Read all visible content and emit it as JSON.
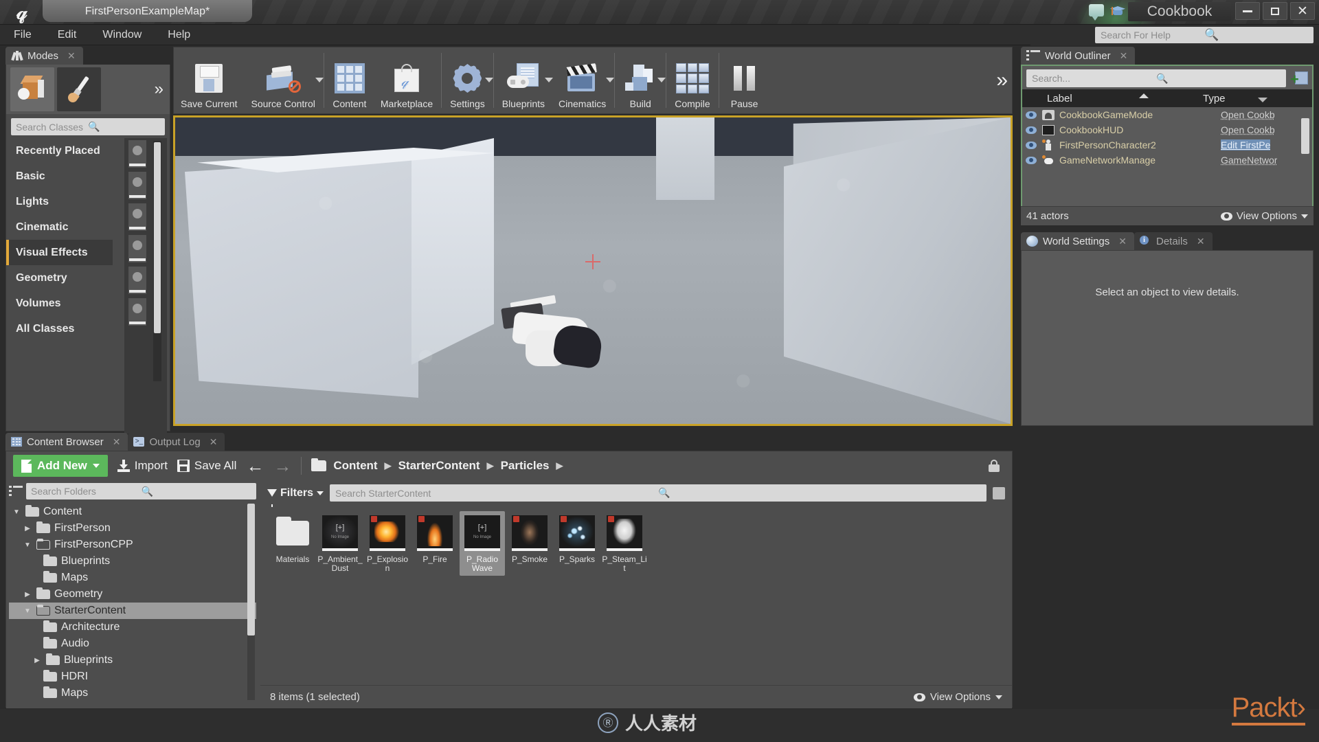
{
  "titlebar": {
    "map_tab": "FirstPersonExampleMap*",
    "project_name": "Cookbook",
    "logo": "unreal-engine-logo",
    "icons": [
      "feedback-speech-icon",
      "tutorials-graduation-icon"
    ],
    "window_controls": {
      "minimize": "–",
      "maximize": "❐",
      "close": "✕"
    }
  },
  "menubar": {
    "items": [
      "File",
      "Edit",
      "Window",
      "Help"
    ]
  },
  "help_search": {
    "placeholder": "Search For Help"
  },
  "modes": {
    "tab_label": "Modes",
    "close": "✕",
    "mode_buttons": [
      "place-mode-icon",
      "paint-mode-icon"
    ],
    "more_chevron": "»",
    "search_placeholder": "Search Classes",
    "categories": [
      {
        "label": "Recently Placed",
        "active": false
      },
      {
        "label": "Basic",
        "active": false
      },
      {
        "label": "Lights",
        "active": false
      },
      {
        "label": "Cinematic",
        "active": false
      },
      {
        "label": "Visual Effects",
        "active": true
      },
      {
        "label": "Geometry",
        "active": false
      },
      {
        "label": "Volumes",
        "active": false
      },
      {
        "label": "All Classes",
        "active": false
      }
    ]
  },
  "toolbar": {
    "items": [
      {
        "label": "Save Current",
        "icon": "floppy-disk-icon",
        "caret": false
      },
      {
        "label": "Source Control",
        "icon": "source-control-icon",
        "caret": true
      },
      {
        "label": "Content",
        "icon": "content-grid-icon",
        "caret": false
      },
      {
        "label": "Marketplace",
        "icon": "marketplace-bag-icon",
        "caret": false
      },
      {
        "label": "Settings",
        "icon": "gear-icon",
        "caret": true
      },
      {
        "label": "Blueprints",
        "icon": "blueprints-icon",
        "caret": true
      },
      {
        "label": "Cinematics",
        "icon": "clapperboard-icon",
        "caret": true
      },
      {
        "label": "Build",
        "icon": "build-blocks-icon",
        "caret": true
      },
      {
        "label": "Compile",
        "icon": "compile-cubes-icon",
        "caret": false
      },
      {
        "label": "Pause",
        "icon": "pause-icon",
        "caret": false
      }
    ],
    "overflow_chevron": "»"
  },
  "viewport": {
    "crosshair": "crosshair-icon",
    "selection_border_color": "#c9a227"
  },
  "outliner": {
    "tab_label": "World Outliner",
    "close": "✕",
    "search_placeholder": "Search...",
    "columns": {
      "label": "Label",
      "type": "Type"
    },
    "rows": [
      {
        "label": "CookbookGameMode",
        "type": "Open Cookb",
        "selected": false,
        "icon": "gamemode-icon"
      },
      {
        "label": "CookbookHUD",
        "type": "Open Cookb",
        "selected": false,
        "icon": "hud-icon"
      },
      {
        "label": "FirstPersonCharacter2",
        "type": "Edit FirstPe",
        "selected": true,
        "icon": "character-icon"
      },
      {
        "label": "GameNetworkManage",
        "type": "GameNetwor",
        "selected": false,
        "icon": "network-icon"
      }
    ],
    "footer": {
      "count": "41 actors",
      "view_options": "View Options"
    }
  },
  "details": {
    "tabs": [
      {
        "label": "World Settings",
        "icon": "world-globe-icon",
        "active": true
      },
      {
        "label": "Details",
        "icon": "details-info-icon",
        "active": false
      }
    ],
    "empty_message": "Select an object to view details."
  },
  "content_browser": {
    "tabs": [
      {
        "label": "Content Browser",
        "icon": "content-browser-icon",
        "active": true
      },
      {
        "label": "Output Log",
        "icon": "output-log-icon",
        "active": false
      }
    ],
    "toolbar": {
      "add_new": "Add New",
      "import": "Import",
      "save_all": "Save All",
      "back_arrow": "←",
      "forward_arrow": "→",
      "lock": "lock-icon"
    },
    "breadcrumbs": [
      "Content",
      "StarterContent",
      "Particles"
    ],
    "folder_search_placeholder": "Search Folders",
    "asset_search_placeholder": "Search StarterContent",
    "filters_label": "Filters",
    "tree": [
      {
        "label": "Content",
        "depth": 0,
        "disclosure": "open",
        "selected": false
      },
      {
        "label": "FirstPerson",
        "depth": 1,
        "disclosure": "closed",
        "selected": false
      },
      {
        "label": "FirstPersonCPP",
        "depth": 1,
        "disclosure": "open",
        "selected": false
      },
      {
        "label": "Blueprints",
        "depth": 2,
        "disclosure": "none",
        "selected": false
      },
      {
        "label": "Maps",
        "depth": 2,
        "disclosure": "none",
        "selected": false
      },
      {
        "label": "Geometry",
        "depth": 1,
        "disclosure": "closed",
        "selected": false
      },
      {
        "label": "StarterContent",
        "depth": 1,
        "disclosure": "open",
        "selected": true
      },
      {
        "label": "Architecture",
        "depth": 2,
        "disclosure": "none",
        "selected": false
      },
      {
        "label": "Audio",
        "depth": 2,
        "disclosure": "none",
        "selected": false
      },
      {
        "label": "Blueprints",
        "depth": 2,
        "disclosure": "closed",
        "selected": false
      },
      {
        "label": "HDRI",
        "depth": 2,
        "disclosure": "none",
        "selected": false
      },
      {
        "label": "Maps",
        "depth": 2,
        "disclosure": "none",
        "selected": false
      }
    ],
    "assets": [
      {
        "name": "Materials",
        "kind": "folder",
        "selected": false
      },
      {
        "name": "P_Ambient_Dust",
        "kind": "particle",
        "fx": "dust",
        "selected": false,
        "no_image": true
      },
      {
        "name": "P_Explosion",
        "kind": "particle",
        "fx": "explosion",
        "selected": false
      },
      {
        "name": "P_Fire",
        "kind": "particle",
        "fx": "fire",
        "selected": false
      },
      {
        "name": "P_Radio Wave",
        "kind": "particle",
        "fx": "none",
        "selected": true,
        "no_image": true
      },
      {
        "name": "P_Smoke",
        "kind": "particle",
        "fx": "smoke",
        "selected": false
      },
      {
        "name": "P_Sparks",
        "kind": "particle",
        "fx": "sparks",
        "selected": false
      },
      {
        "name": "P_Steam_Lit",
        "kind": "particle",
        "fx": "steam",
        "selected": false
      }
    ],
    "thumb_placeholder": "[+]",
    "thumb_placeholder_sub": "No Image",
    "footer": {
      "items": "8 items (1 selected)",
      "view_options": "View Options"
    }
  },
  "watermark": {
    "publisher": "Packt",
    "publisher_caret": "›",
    "site_text": "人人素材",
    "site_ring": "Ⓡ"
  }
}
